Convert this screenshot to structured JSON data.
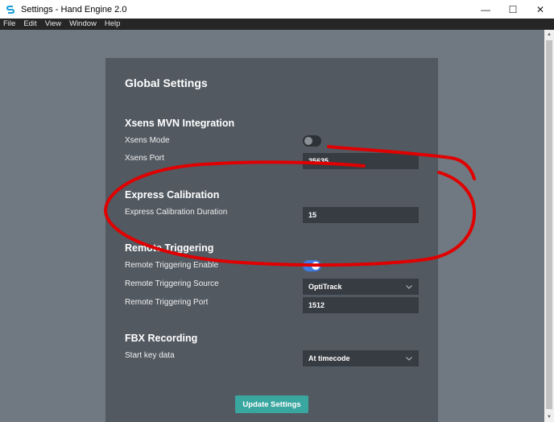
{
  "window": {
    "title": "Settings - Hand Engine 2.0",
    "minimize": "—",
    "maximize": "☐",
    "close": "✕"
  },
  "menu": [
    "File",
    "Edit",
    "View",
    "Window",
    "Help"
  ],
  "panel": {
    "title": "Global Settings",
    "sections": {
      "xsens": {
        "title": "Xsens MVN Integration",
        "mode_label": "Xsens Mode",
        "mode_on": false,
        "port_label": "Xsens Port",
        "port_value": "25635"
      },
      "express": {
        "title": "Express Calibration",
        "duration_label": "Express Calibration Duration",
        "duration_value": "15"
      },
      "remote": {
        "title": "Remote Triggering",
        "enable_label": "Remote Triggering Enable",
        "enable_on": true,
        "source_label": "Remote Triggering Source",
        "source_value": "OptiTrack",
        "port_label": "Remote Triggering Port",
        "port_value": "1512"
      },
      "fbx": {
        "title": "FBX Recording",
        "start_label": "Start key data",
        "start_value": "At timecode"
      }
    },
    "update_button": "Update Settings"
  },
  "colors": {
    "accent_teal": "#3aa6a0",
    "toggle_on": "#3f7be0",
    "annotation_red": "#e00000"
  }
}
